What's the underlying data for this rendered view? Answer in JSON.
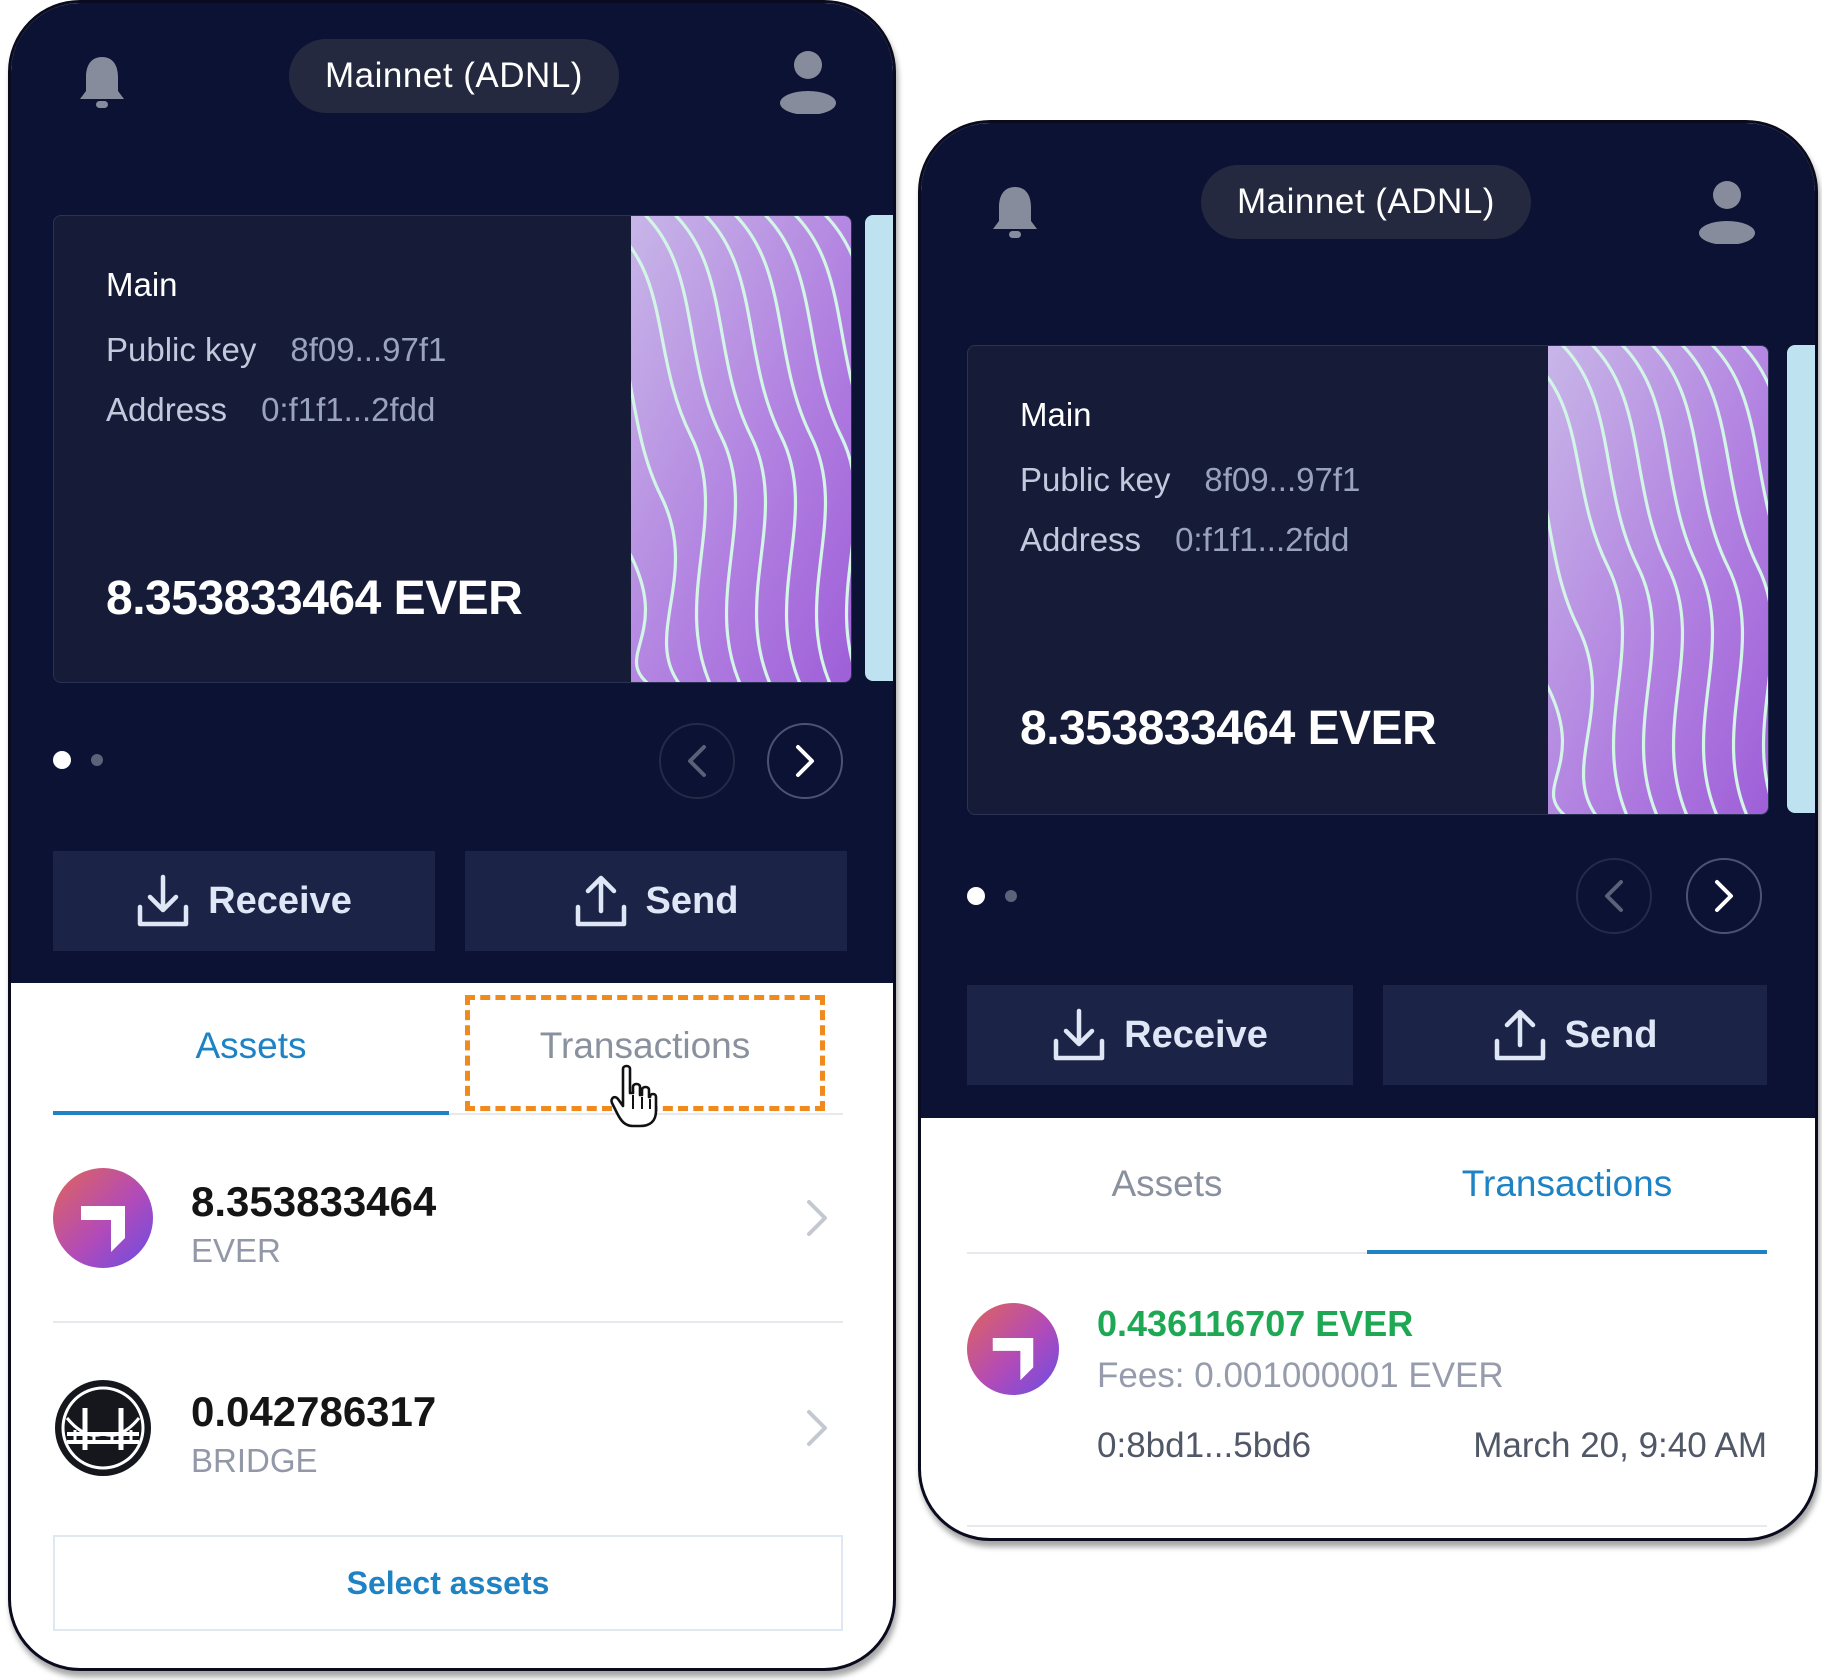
{
  "network": "Mainnet (ADNL)",
  "account": {
    "name": "Main",
    "public_key_label": "Public key",
    "public_key": "8f09...97f1",
    "address_label": "Address",
    "address": "0:f1f1...2fdd",
    "balance": "8.353833464 EVER"
  },
  "actions": {
    "receive": "Receive",
    "send": "Send"
  },
  "tabs": {
    "assets": "Assets",
    "transactions": "Transactions"
  },
  "carousel": {
    "pages": 2,
    "active_page": 1
  },
  "assets": [
    {
      "amount": "8.353833464",
      "symbol": "EVER",
      "icon": "ever-token-icon"
    },
    {
      "amount": "0.042786317",
      "symbol": "BRIDGE",
      "icon": "bridge-token-icon"
    }
  ],
  "select_assets": "Select assets",
  "transaction": {
    "amount": "0.436116707 EVER",
    "fees": "Fees: 0.001000001 EVER",
    "address": "0:8bd1...5bd6",
    "date": "March 20, 9:40 AM"
  },
  "colors": {
    "header_bg": "#0b1233",
    "accent": "#1e83c4",
    "tx_amount": "#1ea854",
    "highlight": "#f08a1c"
  }
}
